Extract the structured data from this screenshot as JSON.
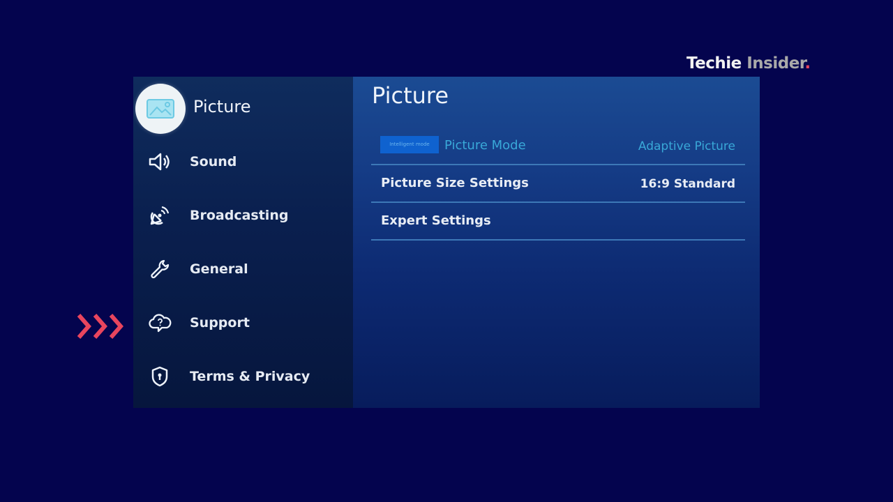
{
  "brand": {
    "part1": "Techie",
    "part2": " Insider",
    "part3": "."
  },
  "sidebar": {
    "active": {
      "label": "Picture",
      "icon": "picture-icon"
    },
    "items": [
      {
        "label": "Sound",
        "icon": "speaker-icon"
      },
      {
        "label": "Broadcasting",
        "icon": "satellite-icon"
      },
      {
        "label": "General",
        "icon": "wrench-icon"
      },
      {
        "label": "Support",
        "icon": "cloud-question-icon"
      },
      {
        "label": "Terms & Privacy",
        "icon": "shield-icon"
      }
    ]
  },
  "main": {
    "title": "Picture",
    "rows": [
      {
        "label": "Picture Mode",
        "value": "Adaptive Picture",
        "badge": "Intelligent mode"
      },
      {
        "label": "Picture Size Settings",
        "value": "16:9 Standard"
      },
      {
        "label": "Expert Settings",
        "value": ""
      }
    ]
  },
  "colors": {
    "background": "#04044e",
    "accent_pointer": "#e8455e",
    "dim_text": "#39a8d8",
    "divider": "#3d78b7"
  },
  "pointer": {
    "icon": "triple-chevron-right-icon"
  }
}
